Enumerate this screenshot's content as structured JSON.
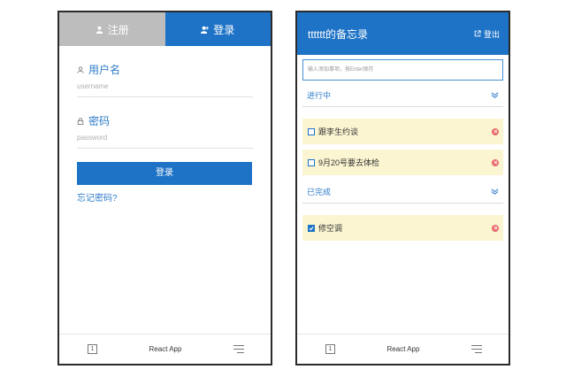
{
  "login_screen": {
    "tabs": {
      "register": "注册",
      "login": "登录"
    },
    "username": {
      "label": "用户名",
      "placeholder": "username"
    },
    "password": {
      "label": "密码",
      "placeholder": "password"
    },
    "submit_label": "登录",
    "forgot_label": "忘记密码?"
  },
  "todo_screen": {
    "title": "tttttt的备忘录",
    "logout_label": "登出",
    "input_placeholder": "输入添加事项，按Enter保存",
    "in_progress": {
      "title": "进行中",
      "items": [
        {
          "text": "跟李生约谈",
          "checked": false
        },
        {
          "text": "9月20号要去体检",
          "checked": false
        }
      ]
    },
    "completed": {
      "title": "已完成",
      "items": [
        {
          "text": "修空调",
          "checked": true
        }
      ]
    }
  },
  "browser_bar": {
    "tab_count": "1",
    "app_name": "React App"
  },
  "colors": {
    "primary": "#1f73c6",
    "inactive_tab": "#bdbdbd",
    "todo_bg": "#fbf5d2",
    "delete": "#e86a6a"
  }
}
